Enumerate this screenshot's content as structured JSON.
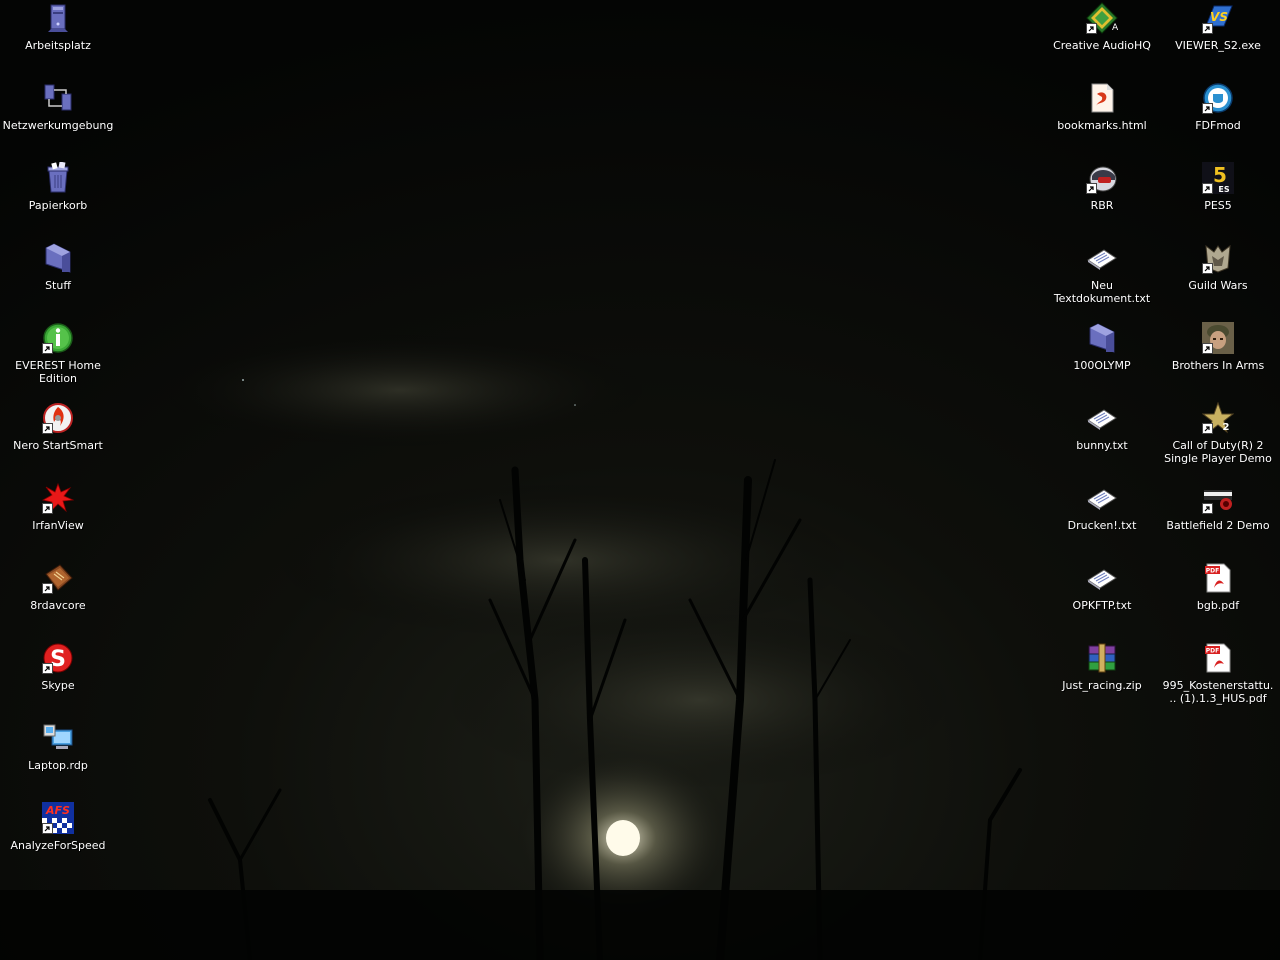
{
  "desktop": {
    "left_icons": [
      {
        "label": "Arbeitsplatz",
        "icon": "my-computer-icon",
        "shortcut": false
      },
      {
        "label": "Netzwerkumgebung",
        "icon": "network-places-icon",
        "shortcut": false
      },
      {
        "label": "Papierkorb",
        "icon": "recycle-bin-icon",
        "shortcut": false
      },
      {
        "label": "Stuff",
        "icon": "folder-icon",
        "shortcut": false
      },
      {
        "label": "EVEREST Home Edition",
        "icon": "everest-icon",
        "shortcut": true
      },
      {
        "label": "Nero StartSmart",
        "icon": "nero-icon",
        "shortcut": true
      },
      {
        "label": "IrfanView",
        "icon": "irfanview-icon",
        "shortcut": true
      },
      {
        "label": "8rdavcore",
        "icon": "8rdavcore-icon",
        "shortcut": true
      },
      {
        "label": "Skype",
        "icon": "skype-icon",
        "shortcut": true
      },
      {
        "label": "Laptop.rdp",
        "icon": "remote-desktop-icon",
        "shortcut": false
      },
      {
        "label": "AnalyzeForSpeed",
        "icon": "afs-icon",
        "shortcut": true
      }
    ],
    "right_col1_icons": [
      {
        "label": "Creative AudioHQ",
        "icon": "creative-audiohq-icon",
        "shortcut": true
      },
      {
        "label": "bookmarks.html",
        "icon": "html-file-icon",
        "shortcut": false
      },
      {
        "label": "RBR",
        "icon": "rbr-icon",
        "shortcut": true
      },
      {
        "label": "Neu Textdokument.txt",
        "icon": "text-file-icon",
        "shortcut": false
      },
      {
        "label": "100OLYMP",
        "icon": "folder-icon",
        "shortcut": false
      },
      {
        "label": "bunny.txt",
        "icon": "text-file-icon",
        "shortcut": false
      },
      {
        "label": "Drucken!.txt",
        "icon": "text-file-icon",
        "shortcut": false
      },
      {
        "label": "OPKFTP.txt",
        "icon": "text-file-icon",
        "shortcut": false
      },
      {
        "label": "Just_racing.zip",
        "icon": "winrar-archive-icon",
        "shortcut": false
      }
    ],
    "right_col2_icons": [
      {
        "label": "VIEWER_S2.exe",
        "icon": "viewer-exe-icon",
        "shortcut": true
      },
      {
        "label": "FDFmod",
        "icon": "fdfmod-icon",
        "shortcut": true
      },
      {
        "label": "PES5",
        "icon": "pes5-icon",
        "shortcut": true
      },
      {
        "label": "Guild Wars",
        "icon": "guild-wars-icon",
        "shortcut": true
      },
      {
        "label": "Brothers In Arms",
        "icon": "brothers-in-arms-icon",
        "shortcut": true
      },
      {
        "label": "Call of Duty(R) 2 Single Player Demo",
        "icon": "call-of-duty-icon",
        "shortcut": true
      },
      {
        "label": "Battlefield 2 Demo",
        "icon": "battlefield-icon",
        "shortcut": true
      },
      {
        "label": "bgb.pdf",
        "icon": "pdf-file-icon",
        "shortcut": false
      },
      {
        "label": "995_Kostenerstattu... (1).1.3_HUS.pdf",
        "icon": "pdf-file-icon",
        "shortcut": false
      }
    ]
  },
  "colors": {
    "label_text": "#ffffff",
    "sky_dark": "#050705",
    "cloud": "#3a3d33",
    "moon": "#fffbe8"
  }
}
